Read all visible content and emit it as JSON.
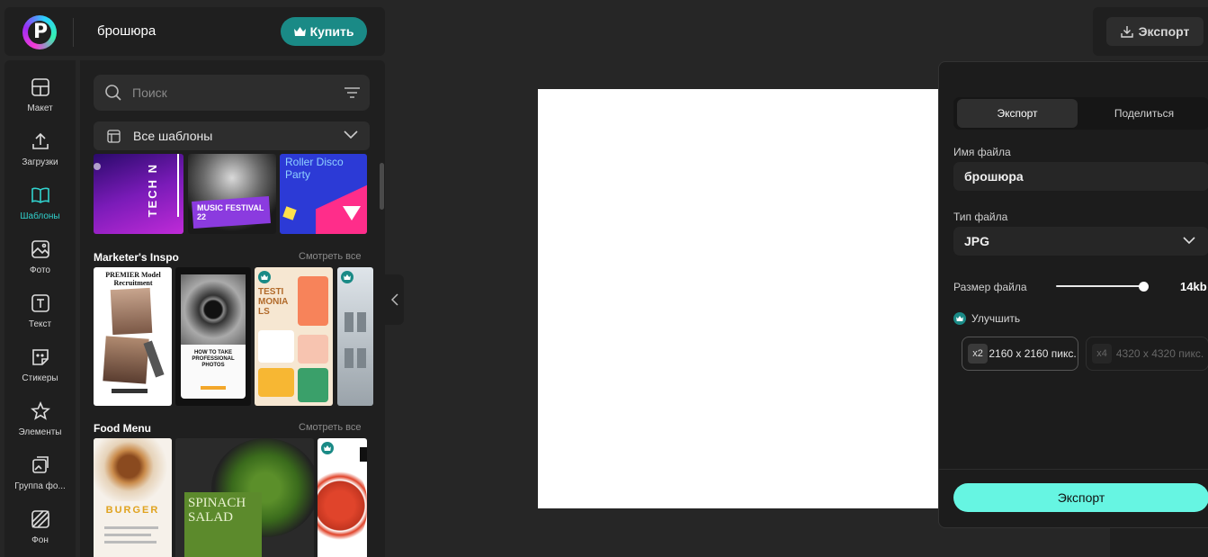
{
  "header": {
    "title": "брошюра",
    "buy_label": "Купить"
  },
  "rail": {
    "items": [
      {
        "label": "Макет"
      },
      {
        "label": "Загрузки"
      },
      {
        "label": "Шаблоны"
      },
      {
        "label": "Фото"
      },
      {
        "label": "Текст"
      },
      {
        "label": "Стикеры"
      },
      {
        "label": "Элементы"
      },
      {
        "label": "Группа фо..."
      },
      {
        "label": "Фон"
      }
    ]
  },
  "templates": {
    "search_placeholder": "Поиск",
    "category": "Все шаблоны",
    "top_row": [
      {
        "text": "TECH N"
      },
      {
        "text": "MUSIC FESTIVAL 22"
      },
      {
        "text": "Roller Disco Party"
      }
    ],
    "sections": [
      {
        "title": "Marketer's Inspo",
        "see_all": "Смотреть все",
        "items": [
          {
            "text": "PREMIER Model Recruitment"
          },
          {
            "text": "HOW TO TAKE PROFESSIONAL PHOTOS"
          },
          {
            "text": "TESTIMONIALS"
          }
        ]
      },
      {
        "title": "Food Menu",
        "see_all": "Смотреть все",
        "items": [
          {
            "text": "BURGER"
          },
          {
            "text": "SPINACH SALAD"
          }
        ]
      }
    ]
  },
  "topbar": {
    "export_label": "Экспорт"
  },
  "export_panel": {
    "tabs": [
      {
        "label": "Экспорт"
      },
      {
        "label": "Поделиться"
      }
    ],
    "filename_label": "Имя файла",
    "filename_value": "брошюра",
    "filetype_label": "Тип файла",
    "filetype_value": "JPG",
    "filesize_label": "Размер файла",
    "filesize_value": "14kb",
    "improve_label": "Улучшить",
    "scale_options": [
      {
        "badge": "x2",
        "text": "2160 x 2160 пикс."
      },
      {
        "badge": "x4",
        "text": "4320 x 4320 пикс."
      }
    ],
    "export_button": "Экспорт"
  },
  "colors": {
    "accent": "#66f5e2",
    "premium": "#1a8a86",
    "panel": "#1f1f1f",
    "background": "#262626"
  }
}
